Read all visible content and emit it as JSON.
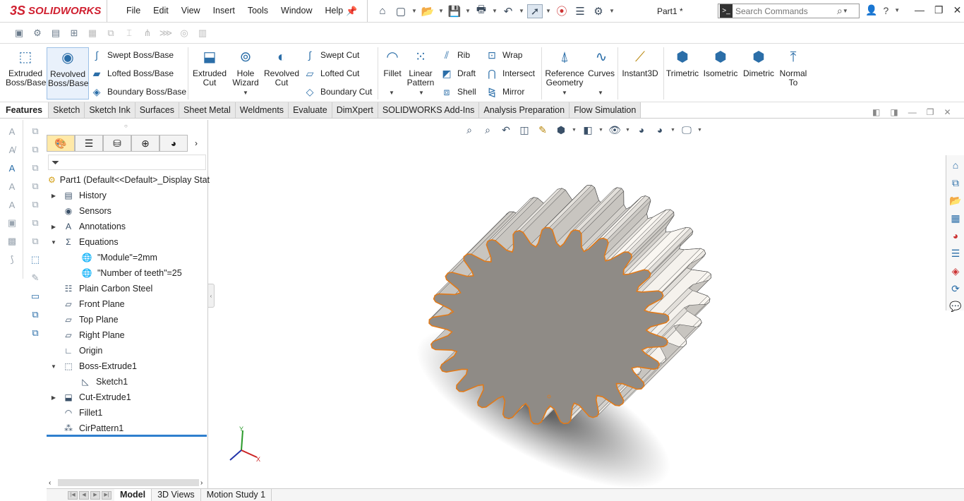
{
  "app": {
    "logo_ds": "3S",
    "logo_name": "SOLIDWORKS",
    "doc_title": "Part1 *"
  },
  "menu": [
    "File",
    "Edit",
    "View",
    "Insert",
    "Tools",
    "Window",
    "Help"
  ],
  "search": {
    "placeholder": "Search Commands"
  },
  "command_manager": {
    "extruded_boss": "Extruded Boss/Base",
    "revolved_boss": "Revolved Boss/Base",
    "swept_boss": "Swept Boss/Base",
    "lofted_boss": "Lofted Boss/Base",
    "boundary_boss": "Boundary Boss/Base",
    "extruded_cut": "Extruded Cut",
    "hole_wizard": "Hole Wizard",
    "revolved_cut": "Revolved Cut",
    "swept_cut": "Swept Cut",
    "lofted_cut": "Lofted Cut",
    "boundary_cut": "Boundary Cut",
    "fillet": "Fillet",
    "linear_pattern": "Linear Pattern",
    "rib": "Rib",
    "draft": "Draft",
    "shell": "Shell",
    "wrap": "Wrap",
    "intersect": "Intersect",
    "mirror": "Mirror",
    "reference_geometry": "Reference Geometry",
    "curves": "Curves",
    "instant3d": "Instant3D",
    "trimetric": "Trimetric",
    "isometric": "Isometric",
    "dimetric": "Dimetric",
    "normal_to": "Normal To"
  },
  "tabs": [
    "Features",
    "Sketch",
    "Sketch Ink",
    "Surfaces",
    "Sheet Metal",
    "Weldments",
    "Evaluate",
    "DimXpert",
    "SOLIDWORKS Add-Ins",
    "Analysis Preparation",
    "Flow Simulation"
  ],
  "tree": {
    "root": "Part1  (Default<<Default>_Display Stat",
    "history": "History",
    "sensors": "Sensors",
    "annotations": "Annotations",
    "equations": "Equations",
    "eq1": "\"Module\"=2mm",
    "eq2": "\"Number of teeth\"=25",
    "material": "Plain Carbon Steel",
    "front_plane": "Front Plane",
    "top_plane": "Top Plane",
    "right_plane": "Right Plane",
    "origin": "Origin",
    "boss_extrude": "Boss-Extrude1",
    "sketch1": "Sketch1",
    "cut_extrude": "Cut-Extrude1",
    "fillet1": "Fillet1",
    "cirpattern": "CirPattern1"
  },
  "bottom_tabs": [
    "Model",
    "3D Views",
    "Motion Study 1"
  ],
  "triad": {
    "y": "Y",
    "x": "X"
  },
  "colors": {
    "accent": "#2f7fce",
    "edge_highlight": "#e07a1a",
    "gear_face": "#8f8b86"
  }
}
